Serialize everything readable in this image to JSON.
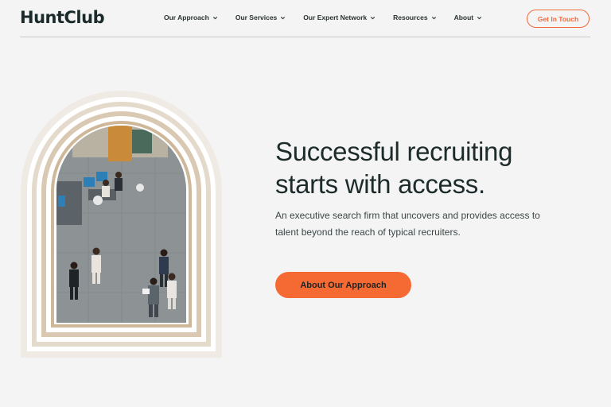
{
  "brand": {
    "logo_text": "HuntClub",
    "accent": "#f46a32"
  },
  "nav": {
    "items": [
      {
        "label": "Our Approach"
      },
      {
        "label": "Our Services"
      },
      {
        "label": "Our Expert Network"
      },
      {
        "label": "Resources"
      },
      {
        "label": "About"
      }
    ],
    "cta_label": "Get In Touch"
  },
  "hero": {
    "title_line1": "Successful recruiting",
    "title_line2": "starts with access.",
    "subtitle_line1": "An executive search firm that uncovers and provides access to",
    "subtitle_line2": "talent beyond the reach of typical recruiters.",
    "cta_label": "About Our Approach"
  },
  "icons": {
    "nav_chevron": "chevron-down-icon"
  }
}
